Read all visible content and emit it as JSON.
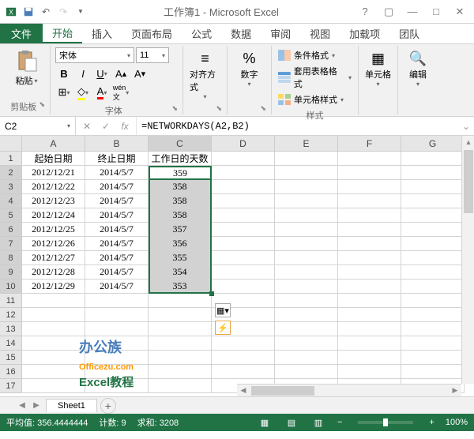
{
  "title": "工作簿1 - Microsoft Excel",
  "tabs": {
    "file": "文件",
    "home": "开始",
    "insert": "插入",
    "layout": "页面布局",
    "formulas": "公式",
    "data": "数据",
    "review": "审阅",
    "view": "视图",
    "addins": "加载项",
    "team": "团队"
  },
  "ribbon": {
    "clipboard": {
      "paste": "粘贴",
      "label": "剪贴板"
    },
    "font": {
      "name": "宋体",
      "size": "11",
      "label": "字体"
    },
    "align": {
      "btn": "对齐方式"
    },
    "number": {
      "btn": "数字"
    },
    "styles": {
      "cond": "条件格式",
      "table": "套用表格格式",
      "cell": "单元格样式",
      "label": "样式"
    },
    "cells": {
      "btn": "单元格"
    },
    "edit": {
      "btn": "编辑"
    }
  },
  "nameBox": "C2",
  "formula": "=NETWORKDAYS(A2,B2)",
  "cols": [
    "A",
    "B",
    "C",
    "D",
    "E",
    "F",
    "G"
  ],
  "headers": {
    "A": "起始日期",
    "B": "终止日期",
    "C": "工作日的天数"
  },
  "rows": [
    {
      "A": "2012/12/21",
      "B": "2014/5/7",
      "C": "359"
    },
    {
      "A": "2012/12/22",
      "B": "2014/5/7",
      "C": "358"
    },
    {
      "A": "2012/12/23",
      "B": "2014/5/7",
      "C": "358"
    },
    {
      "A": "2012/12/24",
      "B": "2014/5/7",
      "C": "358"
    },
    {
      "A": "2012/12/25",
      "B": "2014/5/7",
      "C": "357"
    },
    {
      "A": "2012/12/26",
      "B": "2014/5/7",
      "C": "356"
    },
    {
      "A": "2012/12/27",
      "B": "2014/5/7",
      "C": "355"
    },
    {
      "A": "2012/12/28",
      "B": "2014/5/7",
      "C": "354"
    },
    {
      "A": "2012/12/29",
      "B": "2014/5/7",
      "C": "353"
    }
  ],
  "activeCellValue": "359",
  "sheet": "Sheet1",
  "status": {
    "avg": "平均值: 356.4444444",
    "count": "计数: 9",
    "sum": "求和: 3208",
    "zoom": "100%"
  },
  "watermark": {
    "t1": "办公族",
    "t2": "Officezu.com",
    "t3": "Excel教程"
  }
}
